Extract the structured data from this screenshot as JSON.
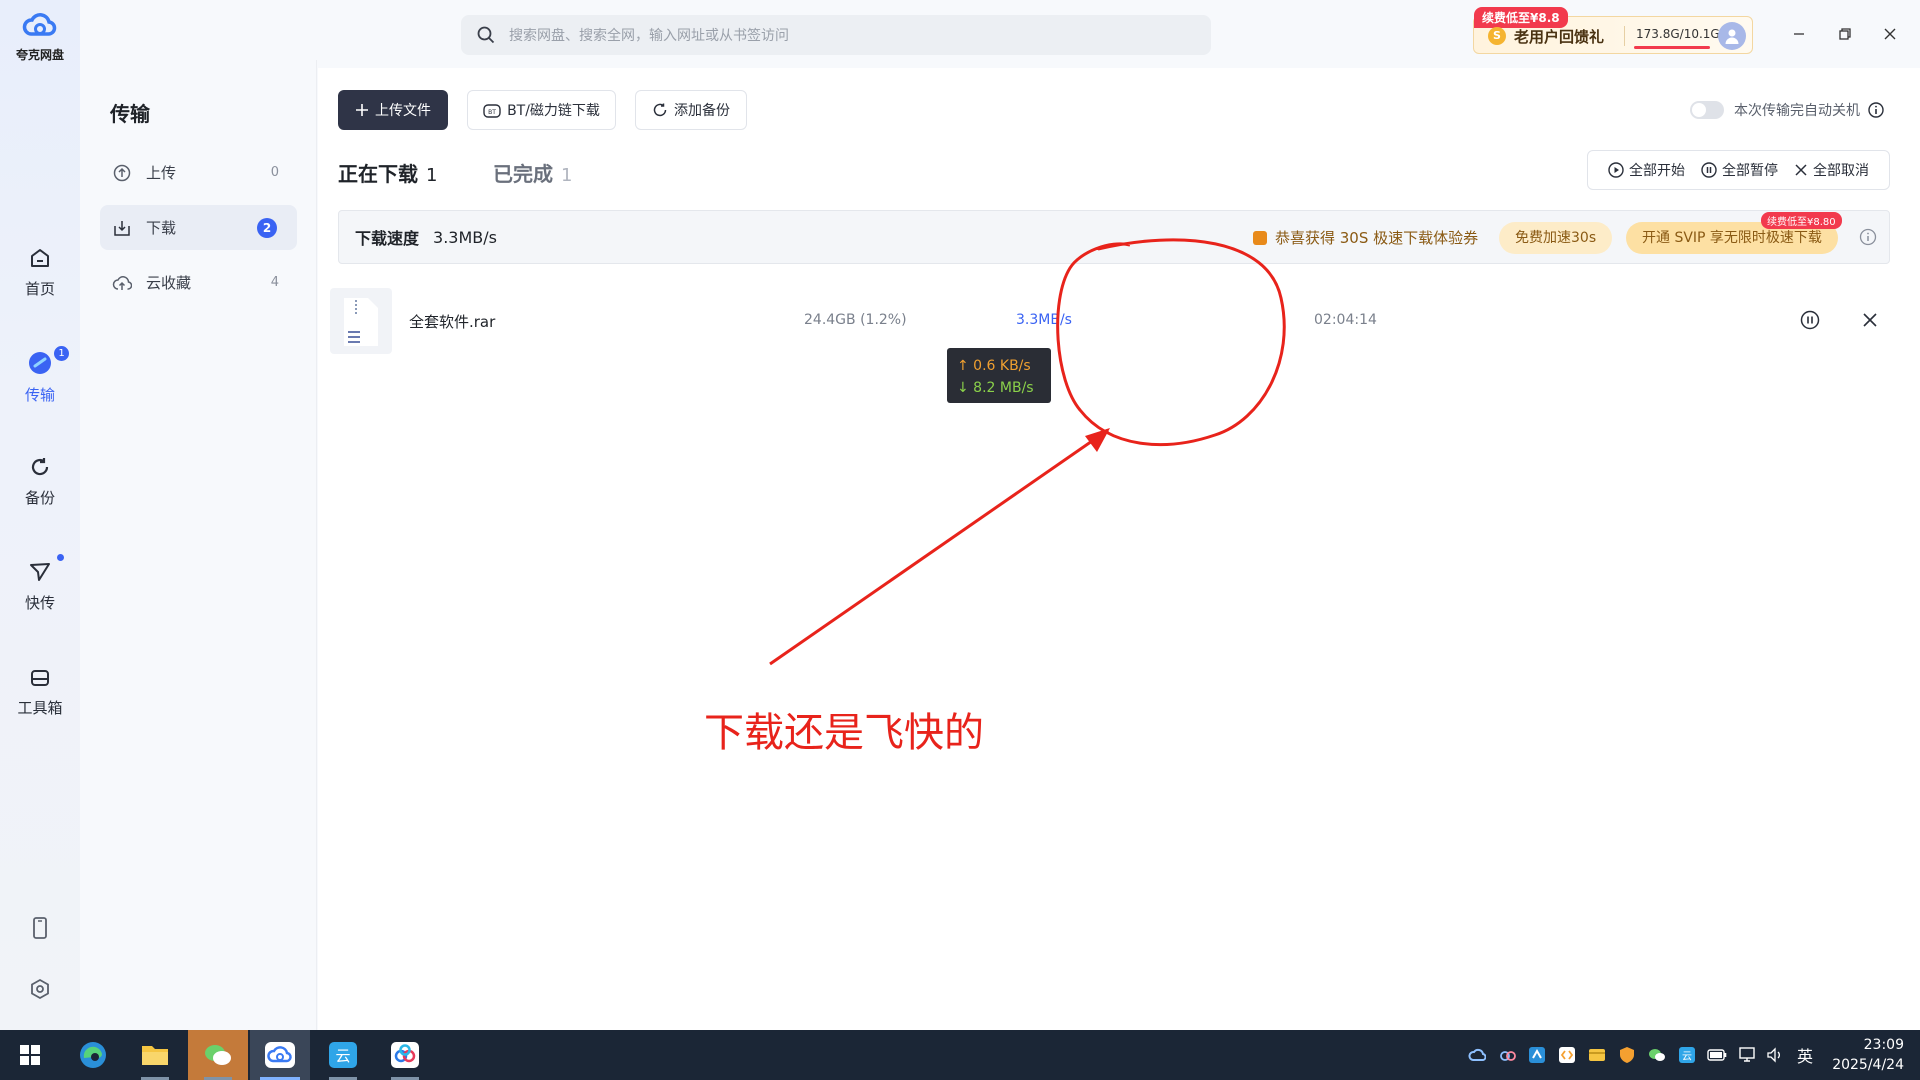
{
  "app": {
    "name": "夸克网盘"
  },
  "rail": {
    "items": [
      {
        "label": "首页",
        "icon": "home-icon"
      },
      {
        "label": "传输",
        "icon": "transfer-icon",
        "badge": "1",
        "active": true
      },
      {
        "label": "备份",
        "icon": "backup-icon"
      },
      {
        "label": "快传",
        "icon": "send-icon",
        "dot": true
      },
      {
        "label": "工具箱",
        "icon": "toolbox-icon"
      }
    ],
    "bottom_icons": [
      "phone-icon",
      "settings-icon"
    ]
  },
  "search": {
    "placeholder": "搜索网盘、搜索全网，输入网址或从书签访问"
  },
  "promo": {
    "tag": "续费低至¥8.8",
    "text": "老用户回馈礼",
    "storage": "173.8G/10.1G"
  },
  "sidebar": {
    "title": "传输",
    "items": [
      {
        "label": "上传",
        "count": "0"
      },
      {
        "label": "下载",
        "count": "2",
        "active": true
      },
      {
        "label": "云收藏",
        "count": "4"
      }
    ]
  },
  "toolbar": {
    "upload_label": "上传文件",
    "bt_label": "BT/磁力链下载",
    "backup_label": "添加备份",
    "auto_shutdown_label": "本次传输完自动关机"
  },
  "tabs": [
    {
      "label": "正在下载",
      "count": "1",
      "active": true
    },
    {
      "label": "已完成",
      "count": "1",
      "active": false
    }
  ],
  "bulk_actions": {
    "start_all": "全部开始",
    "pause_all": "全部暂停",
    "cancel_all": "全部取消"
  },
  "speed_bar": {
    "label": "下载速度",
    "value": "3.3MB/s",
    "voucher_text": "恭喜获得 30S 极速下载体验券",
    "free_button": "免费加速30s",
    "svip_button": "开通 SVIP 享无限时极速下载",
    "svip_tag": "续费低至¥8.80"
  },
  "downloads": [
    {
      "name": "全套软件.rar",
      "size": "24.4GB (1.2%)",
      "speed": "3.3MB/s",
      "tooltip_up": "↑ 0.6 KB/s",
      "tooltip_down": "↓ 8.2 MB/s",
      "remaining": "02:04:14"
    }
  ],
  "annotation": {
    "text": "下载还是飞快的",
    "color": "#e8231b"
  },
  "taskbar": {
    "time": "23:09",
    "date": "2025/4/24",
    "ime": "英"
  },
  "colors": {
    "accent": "#3a63f3",
    "primary_button": "#2f3447",
    "annotation": "#e8231b"
  }
}
